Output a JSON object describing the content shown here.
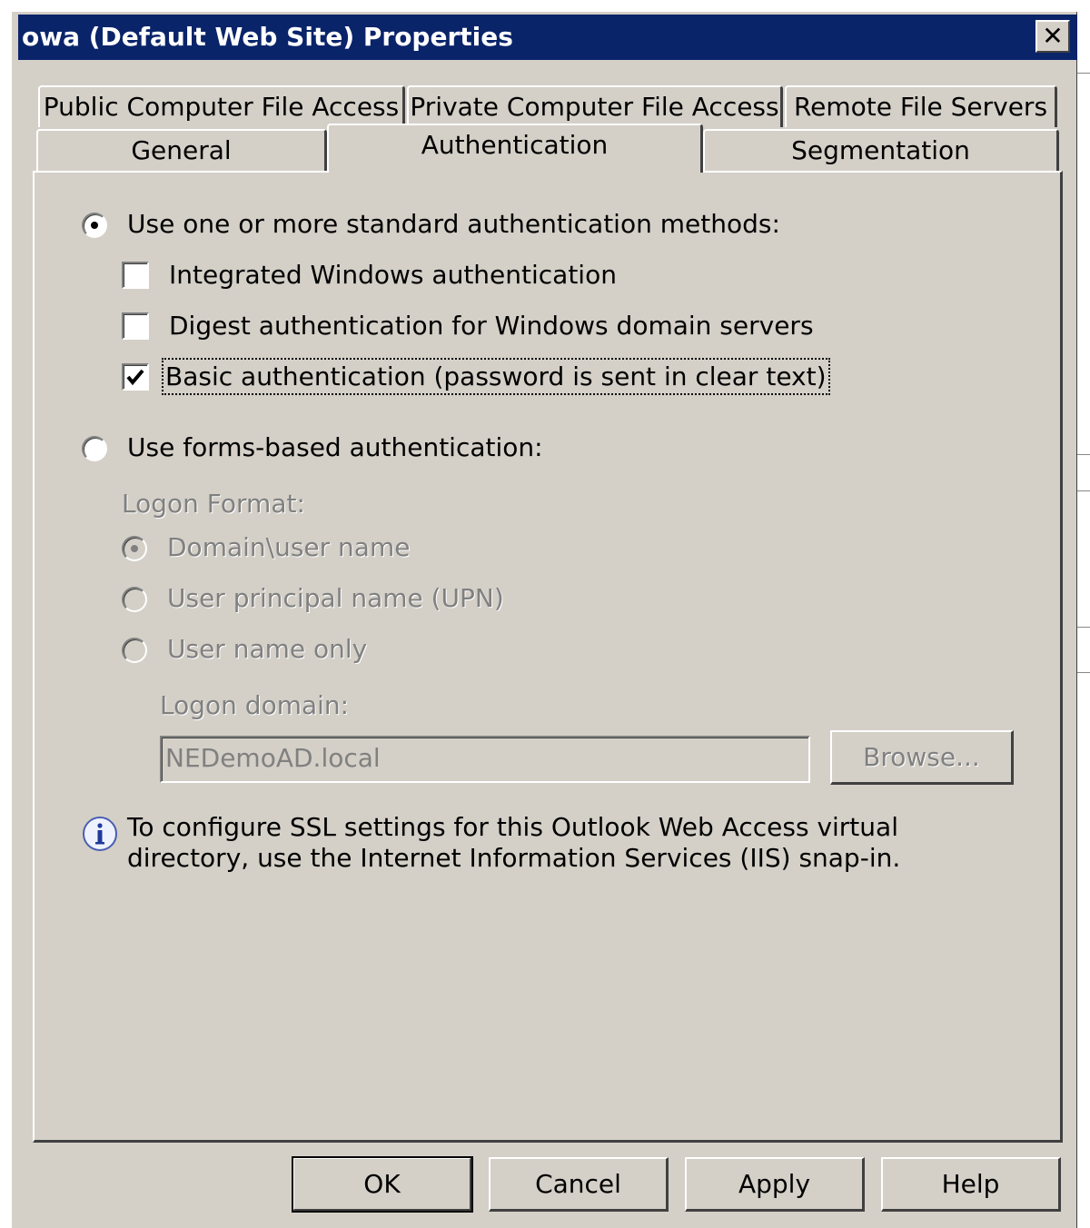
{
  "window": {
    "title": "owa (Default Web Site) Properties"
  },
  "tabs_row1": [
    {
      "label": "Public Computer File Access"
    },
    {
      "label": "Private Computer File Access"
    },
    {
      "label": "Remote File Servers"
    }
  ],
  "tabs_row2": [
    {
      "label": "General"
    },
    {
      "label": "Authentication",
      "selected": true
    },
    {
      "label": "Segmentation"
    }
  ],
  "auth": {
    "standard_label": "Use one or more standard authentication methods:",
    "standard_selected": true,
    "integrated_label": "Integrated Windows authentication",
    "integrated_checked": false,
    "digest_label": "Digest authentication for Windows domain servers",
    "digest_checked": false,
    "basic_label": "Basic authentication (password is sent in clear text)",
    "basic_checked": true,
    "forms_label": "Use forms-based authentication:",
    "forms_selected": false
  },
  "logon": {
    "format_label": "Logon Format:",
    "options": [
      {
        "label": "Domain\\user name",
        "selected": true
      },
      {
        "label": "User principal name (UPN)",
        "selected": false
      },
      {
        "label": "User name only",
        "selected": false
      }
    ],
    "domain_label": "Logon domain:",
    "domain_value": "NEDemoAD.local",
    "browse_label": "Browse..."
  },
  "info": {
    "text": "To configure SSL settings for this Outlook Web Access virtual directory, use the Internet Information Services (IIS) snap-in."
  },
  "buttons": {
    "ok": "OK",
    "cancel": "Cancel",
    "apply": "Apply",
    "help": "Help"
  },
  "icons": {
    "close": "close-icon",
    "info": "info-icon",
    "check": "checkmark-icon"
  }
}
